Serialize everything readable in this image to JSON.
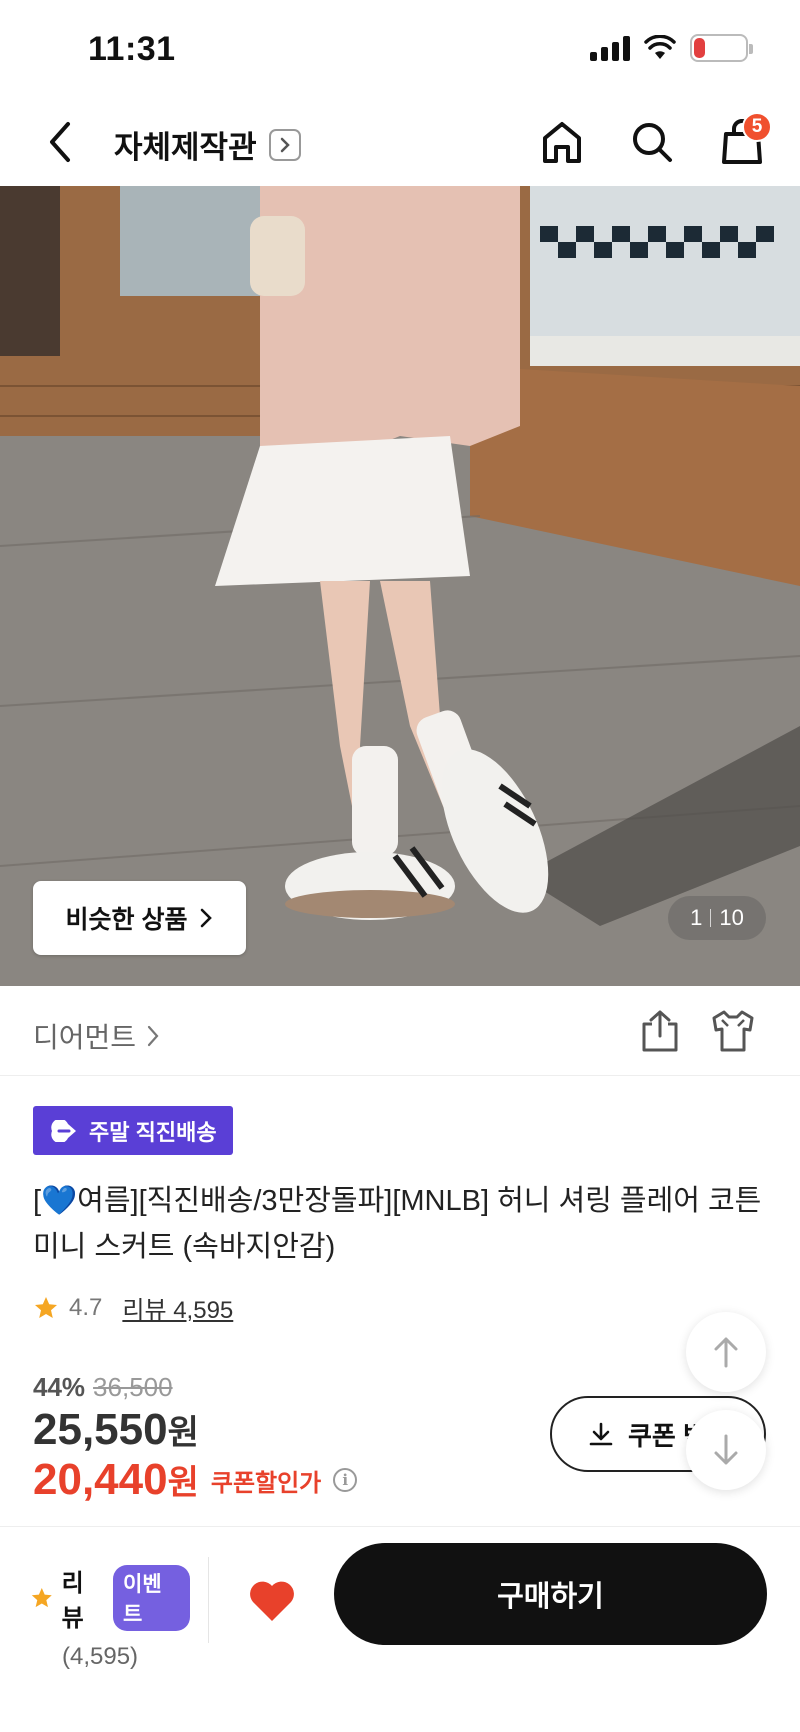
{
  "status_bar": {
    "time": "11:31",
    "battery": "4"
  },
  "header": {
    "title": "자체제작관",
    "cart_count": "5"
  },
  "gallery": {
    "similar_label": "비슷한 상품",
    "current": "1",
    "total": "10"
  },
  "brand": {
    "name": "디어먼트"
  },
  "product": {
    "delivery_badge": "주말 직진배송",
    "title": "[💙여름][직진배송/3만장돌파][MNLB] 허니 셔링 플레어 코튼 미니 스커트 (속바지안감)",
    "rating": "4.7",
    "review_label": "리뷰 4,595"
  },
  "price": {
    "discount_rate": "44%",
    "original": "36,500",
    "sale": "25,550",
    "sale_unit": "원",
    "coupon_price": "20,440",
    "coupon_unit": "원",
    "coupon_label": "쿠폰할인가",
    "coupon_button": "쿠폰 받기"
  },
  "bottom_bar": {
    "review_label": "리뷰",
    "event_badge": "이벤트",
    "review_count": "(4,595)",
    "buy_label": "구매하기"
  },
  "colors": {
    "accent_purple": "#5a3fd6",
    "price_red": "#e8412b",
    "heart_red": "#e8412b",
    "badge_orange": "#f0502e"
  },
  "icons": [
    "back-icon",
    "chevron-right-icon",
    "home-icon",
    "search-icon",
    "shopping-bag-icon",
    "share-icon",
    "fit-icon",
    "star-icon",
    "info-icon",
    "download-icon",
    "arrow-up-icon",
    "arrow-down-icon",
    "heart-icon"
  ]
}
